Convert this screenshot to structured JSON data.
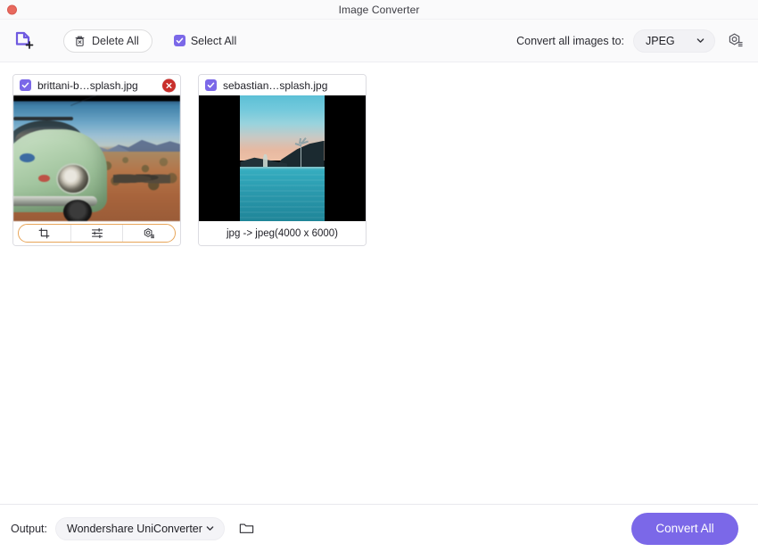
{
  "window": {
    "title": "Image Converter",
    "close_icon": "close-traffic-light"
  },
  "toolbar": {
    "logo_icon": "add-file-icon",
    "delete_all_label": "Delete All",
    "delete_icon": "trash-icon",
    "select_all_label": "Select All",
    "select_all_checked": true,
    "convert_label": "Convert all images to:",
    "format_value": "JPEG",
    "format_chevron_icon": "chevron-down-icon",
    "settings_icon": "gear-hex-icon"
  },
  "cards": [
    {
      "filename": "brittani-b…splash.jpg",
      "checked": true,
      "close_icon": "remove-circle-icon",
      "footer_type": "actions",
      "actions": [
        {
          "icon": "crop-icon",
          "name": "crop"
        },
        {
          "icon": "adjust-sliders-icon",
          "name": "adjust"
        },
        {
          "icon": "gear-hex-icon",
          "name": "settings"
        }
      ],
      "thumb": "vw-beetle-desert"
    },
    {
      "filename": "sebastian…splash.jpg",
      "checked": true,
      "footer_type": "text",
      "footer_text": "jpg -> jpeg(4000 x 6000)",
      "thumb": "infinity-pool-sunset"
    }
  ],
  "bottom": {
    "output_label": "Output:",
    "output_value": "Wondershare UniConverter",
    "output_chevron_icon": "chevron-down-icon",
    "folder_icon": "folder-icon",
    "convert_all_label": "Convert All"
  },
  "colors": {
    "accent_purple": "#7b68e8",
    "accent_orange": "#e8a558",
    "close_red": "#c9302c",
    "traffic_red": "#e8695e",
    "toolbar_bg": "#fafafb",
    "content_bg": "#ffffff"
  }
}
